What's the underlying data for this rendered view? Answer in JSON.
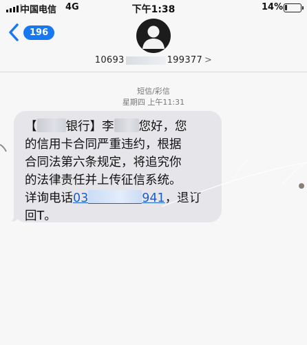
{
  "status_bar": {
    "carrier": "中国电信",
    "network": "4G",
    "time": "下午1:38",
    "battery": "14%",
    "battery_level": 0.14
  },
  "header": {
    "back_count": "196",
    "sender_prefix": "10693",
    "sender_suffix": "199377",
    "sender_chevron": ">"
  },
  "thread": {
    "message_type": "短信/彩信",
    "timestamp": "星期四 上午11:31"
  },
  "message": {
    "line1_open": "【",
    "line1_bank": "银行】李",
    "line1_greeting": "您好，您",
    "line2": "的信用卡合同严重违约，根据",
    "line3": "合同法第六条规定，将追究你",
    "line4": "的法律责任并上传征信系统。",
    "line5_label": "详询电话",
    "phone_start": "03",
    "phone_end": "941",
    "line5_tail": "，退订",
    "line6": "回T。"
  }
}
